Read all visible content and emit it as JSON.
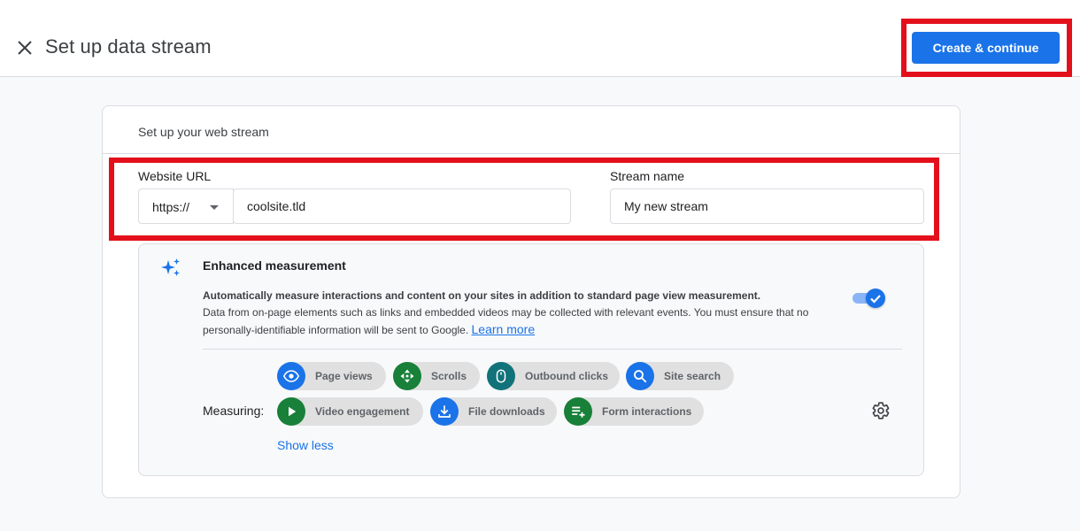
{
  "header": {
    "title": "Set up data stream",
    "primary_button": "Create & continue"
  },
  "card": {
    "title": "Set up your web stream",
    "website_url": {
      "label": "Website URL",
      "protocol": "https://",
      "value": "coolsite.tld"
    },
    "stream_name": {
      "label": "Stream name",
      "value": "My new stream"
    }
  },
  "enhanced_measurement": {
    "title": "Enhanced measurement",
    "description_bold": "Automatically measure interactions and content on your sites in addition to standard page view measurement.",
    "description": "Data from on-page elements such as links and embedded videos may be collected with relevant events. You must ensure that no personally-identifiable information will be sent to Google.",
    "learn_more": "Learn more",
    "enabled": true,
    "measuring_label": "Measuring:",
    "chips": [
      {
        "label": "Page views",
        "icon": "eye-icon",
        "color": "#1a73e8"
      },
      {
        "label": "Scrolls",
        "icon": "scroll-icon",
        "color": "#188038"
      },
      {
        "label": "Outbound clicks",
        "icon": "mouse-icon",
        "color": "#12727a"
      },
      {
        "label": "Site search",
        "icon": "search-icon",
        "color": "#1a73e8"
      },
      {
        "label": "Video engagement",
        "icon": "play-icon",
        "color": "#188038"
      },
      {
        "label": "File downloads",
        "icon": "download-icon",
        "color": "#1a73e8"
      },
      {
        "label": "Form interactions",
        "icon": "form-icon",
        "color": "#188038"
      }
    ],
    "show_less": "Show less"
  },
  "colors": {
    "primary": "#1a73e8",
    "highlight": "#e3101b"
  }
}
